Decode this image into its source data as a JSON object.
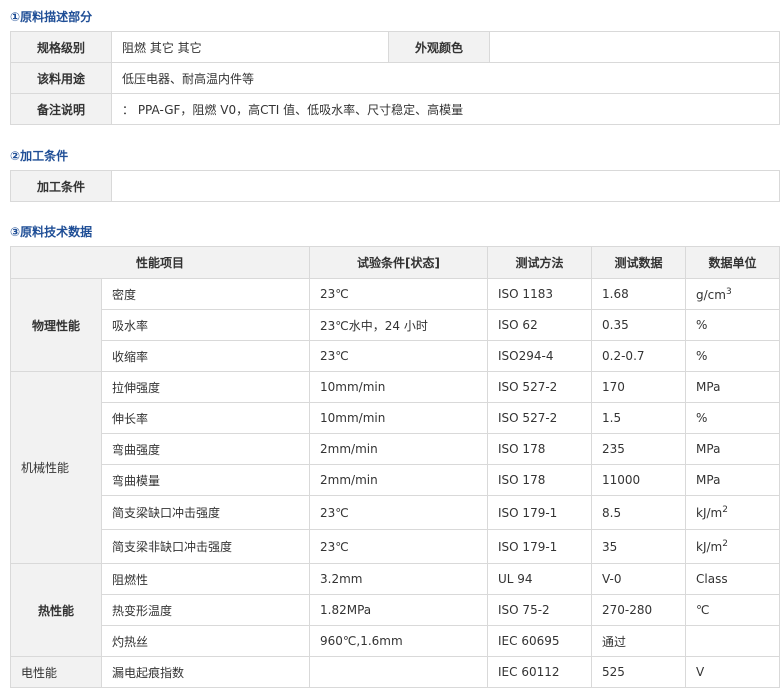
{
  "section1": {
    "title": "①原料描述部分",
    "rows": [
      {
        "label": "规格级别",
        "value": "阻燃 其它 其它",
        "extra_label": "外观颜色",
        "extra_value": ""
      },
      {
        "label": "该料用途",
        "value": "低压电器、耐高温内件等"
      },
      {
        "label": "备注说明",
        "value": "：  PPA-GF，阻燃 V0，高CTI 值、低吸水率、尺寸稳定、高模量"
      }
    ]
  },
  "section2": {
    "title": "②加工条件",
    "label": "加工条件",
    "value": ""
  },
  "section3": {
    "title": "③原料技术数据",
    "headers": [
      "性能项目",
      "试验条件[状态]",
      "测试方法",
      "测试数据",
      "数据单位"
    ],
    "groups": [
      {
        "name": "物理性能",
        "rows": [
          {
            "item": "密度",
            "condition": "23℃",
            "method": "ISO 1183",
            "value": "1.68",
            "unit": "g/cm",
            "unit_sup": "3"
          },
          {
            "item": "吸水率",
            "condition": "23℃水中，24 小时",
            "method": "ISO 62",
            "value": "0.35",
            "unit": "%"
          },
          {
            "item": "收缩率",
            "condition": "23℃",
            "method": "ISO294-4",
            "value": "0.2-0.7",
            "unit": "%"
          }
        ]
      },
      {
        "name": "机械性能",
        "rows": [
          {
            "item": "拉伸强度",
            "condition": "10mm/min",
            "method": "ISO 527-2",
            "value": "170",
            "unit": "MPa"
          },
          {
            "item": "伸长率",
            "condition": "10mm/min",
            "method": "ISO 527-2",
            "value": "1.5",
            "unit": "%"
          },
          {
            "item": "弯曲强度",
            "condition": "2mm/min",
            "method": "ISO 178",
            "value": "235",
            "unit": "MPa"
          },
          {
            "item": "弯曲模量",
            "condition": "2mm/min",
            "method": "ISO 178",
            "value": "11000",
            "unit": "MPa"
          },
          {
            "item": "简支梁缺口冲击强度",
            "condition": "23℃",
            "method": "ISO 179-1",
            "value": "8.5",
            "unit": "kJ/m",
            "unit_sup": "2"
          },
          {
            "item": "简支梁非缺口冲击强度",
            "condition": "23℃",
            "method": "ISO 179-1",
            "value": "35",
            "unit": "kJ/m",
            "unit_sup": "2"
          }
        ]
      },
      {
        "name": "热性能",
        "rows": [
          {
            "item": "阻燃性",
            "condition": "3.2mm",
            "method": "UL 94",
            "value": "V-0",
            "unit": "Class"
          },
          {
            "item": "热变形温度",
            "condition": "1.82MPa",
            "method": "ISO 75-2",
            "value": "270-280",
            "unit": "℃"
          },
          {
            "item": "灼热丝",
            "condition": "960℃,1.6mm",
            "method": "IEC 60695",
            "value": "通过",
            "unit": ""
          }
        ]
      },
      {
        "name": "电性能",
        "rows": [
          {
            "item": "漏电起痕指数",
            "condition": "",
            "method": "IEC 60112",
            "value": "525",
            "unit": "V"
          }
        ]
      }
    ]
  }
}
